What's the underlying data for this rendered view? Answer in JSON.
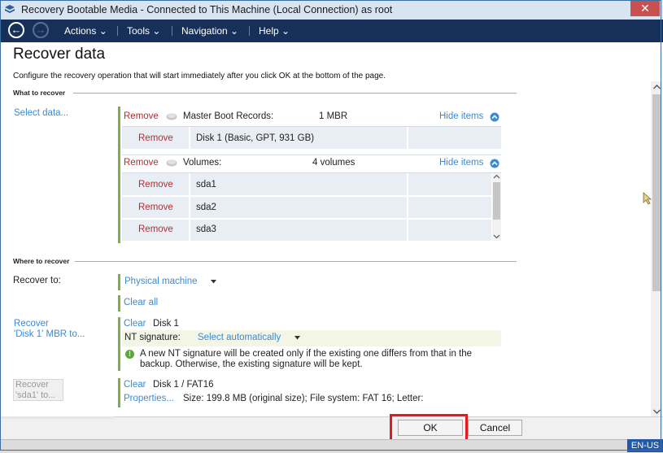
{
  "window": {
    "title": "Recovery Bootable Media - Connected to This Machine (Local Connection) as root",
    "close_symbol": "✕"
  },
  "menubar": {
    "back_symbol": "←",
    "forward_symbol": "→",
    "items": [
      {
        "label": "Actions"
      },
      {
        "label": "Tools"
      },
      {
        "label": "Navigation"
      },
      {
        "label": "Help"
      }
    ],
    "chevron": "⌄"
  },
  "page": {
    "title": "Recover data",
    "subtitle": "Configure the recovery operation that will start immediately after you click OK at the bottom of the page."
  },
  "what_to_recover": {
    "header": "What to recover",
    "select_link": "Select data...",
    "mbr_group": {
      "remove": "Remove",
      "label": "Master Boot Records:",
      "count": "1 MBR",
      "hide": "Hide items",
      "rows": [
        {
          "remove": "Remove",
          "name": "Disk 1 (Basic, GPT, 931 GB)"
        }
      ]
    },
    "volumes_group": {
      "remove": "Remove",
      "label": "Volumes:",
      "count": "4 volumes",
      "hide": "Hide items",
      "rows": [
        {
          "remove": "Remove",
          "name": "sda1"
        },
        {
          "remove": "Remove",
          "name": "sda2"
        },
        {
          "remove": "Remove",
          "name": "sda3"
        }
      ]
    }
  },
  "where_to_recover": {
    "header": "Where to recover",
    "recover_to_label": "Recover to:",
    "recover_to_value": "Physical machine",
    "clear_all": "Clear all",
    "mbr_item": {
      "label_line1": "Recover",
      "label_line2": "'Disk 1' MBR to...",
      "clear": "Clear",
      "target": "Disk 1",
      "nt_label": "NT signature:",
      "nt_value": "Select automatically",
      "info_line1": "A new NT signature will be created only if the existing one differs from that in the",
      "info_line2": "backup. Otherwise, the existing signature will be kept."
    },
    "sda1_item": {
      "label_line1": "Recover",
      "label_line2": "'sda1' to...",
      "clear": "Clear",
      "target": "Disk 1 / FAT16",
      "properties": "Properties...",
      "details": "Size: 199.8 MB (original size); File system: FAT 16; Letter:"
    }
  },
  "footer": {
    "ok": "OK",
    "cancel": "Cancel",
    "language": "EN-US"
  },
  "colors": {
    "accent_link": "#3a8ad6",
    "remove_red": "#c0282b",
    "menubar_bg": "#17305a",
    "highlight_red": "#e01b22",
    "group_green": "#7bb04a"
  }
}
